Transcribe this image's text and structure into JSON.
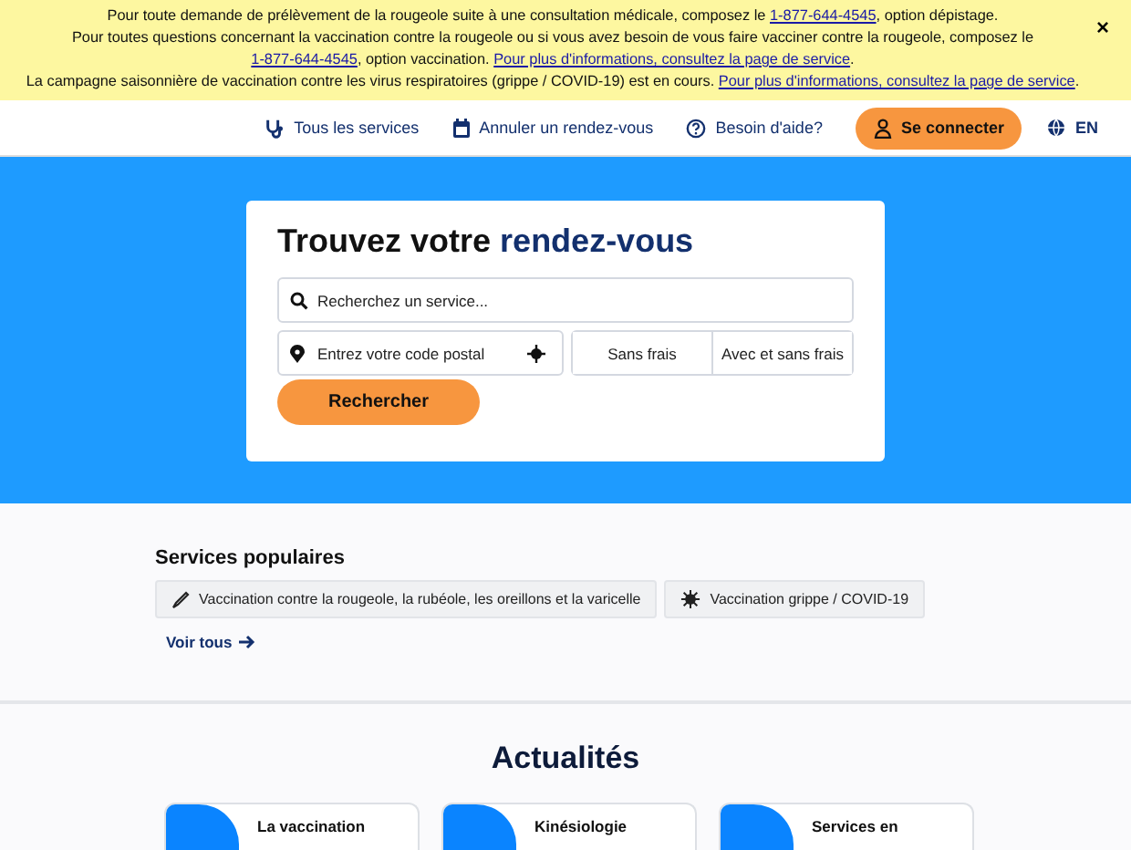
{
  "banner": {
    "paragraphs": [
      {
        "parts": [
          {
            "kind": "text",
            "text": "Pour toute demande de prélèvement de la rougeole suite à une consultation médicale, composez le "
          },
          {
            "kind": "link",
            "text": "1-877-644-4545"
          },
          {
            "kind": "text",
            "text": ", option dépistage."
          }
        ]
      },
      {
        "parts": [
          {
            "kind": "text",
            "text": "Pour toutes questions concernant la vaccination contre la rougeole ou si vous avez besoin de vous faire vacciner contre la rougeole, composez le "
          },
          {
            "kind": "link",
            "text": "1-877-644-4545"
          },
          {
            "kind": "text",
            "text": ", option vaccination. "
          },
          {
            "kind": "link",
            "text": "Pour plus d'informations, consultez la page de service"
          },
          {
            "kind": "text",
            "text": "."
          }
        ]
      },
      {
        "parts": [
          {
            "kind": "text",
            "text": "La campagne saisonnière de vaccination contre les virus respiratoires (grippe / COVID-19) est en cours. "
          },
          {
            "kind": "link",
            "text": "Pour plus d'informations, consultez la page de service"
          },
          {
            "kind": "text",
            "text": "."
          }
        ]
      }
    ],
    "close": "×"
  },
  "nav": {
    "items": [
      {
        "label": "Tous les services"
      },
      {
        "label": "Annuler un rendez-vous"
      },
      {
        "label": "Besoin d'aide?"
      }
    ],
    "login": "Se connecter",
    "language": "EN"
  },
  "search": {
    "title": "Trouvez votre",
    "title_highlight": "rendez-vous",
    "service_placeholder": "Recherchez un service...",
    "postal_placeholder": "Entrez votre code postal",
    "fee_options": [
      "Sans frais",
      "Avec et sans frais"
    ],
    "button": "Rechercher"
  },
  "popular": {
    "heading": "Services populaires",
    "chips": [
      {
        "label": "Vaccination contre la rougeole, la rubéole, les oreillons et la varicelle"
      },
      {
        "label": "Vaccination grippe / COVID-19"
      }
    ],
    "see_all": "Voir tous"
  },
  "news": {
    "heading": "Actualités",
    "cards": [
      {
        "title": "La vaccination"
      },
      {
        "title": "Kinésiologie"
      },
      {
        "title": "Services en"
      }
    ]
  }
}
